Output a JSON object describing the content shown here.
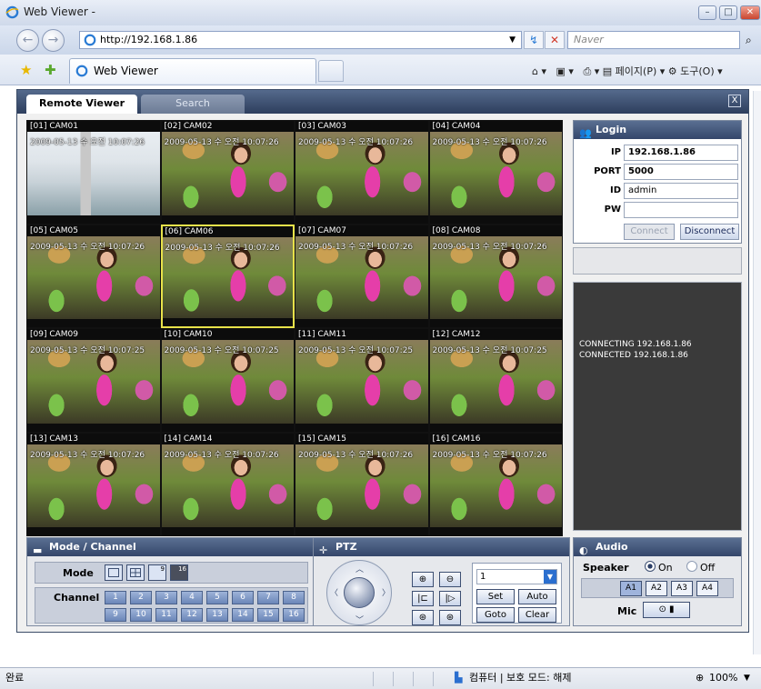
{
  "window": {
    "title": "Web Viewer -"
  },
  "address": {
    "url": "http://192.168.1.86",
    "search_placeholder": "Naver"
  },
  "tab": {
    "title": "Web Viewer"
  },
  "toolbar": {
    "page_label": "페이지(P)",
    "tools_label": "도구(O)"
  },
  "app": {
    "tabs": [
      "Remote Viewer",
      "Search"
    ],
    "close_label": "X"
  },
  "cameras": [
    {
      "label": "[01] CAM01",
      "timestamp": "2009-05-13 수 오전 10:07:26"
    },
    {
      "label": "[02] CAM02",
      "timestamp": "2009-05-13 수 오전 10:07:26"
    },
    {
      "label": "[03] CAM03",
      "timestamp": "2009-05-13 수 오전 10:07:26"
    },
    {
      "label": "[04] CAM04",
      "timestamp": "2009-05-13 수 오전 10:07:26"
    },
    {
      "label": "[05] CAM05",
      "timestamp": "2009-05-13 수 오전 10:07:26"
    },
    {
      "label": "[06] CAM06",
      "timestamp": "2009-05-13 수 오전 10:07:26"
    },
    {
      "label": "[07] CAM07",
      "timestamp": "2009-05-13 수 오전 10:07:26"
    },
    {
      "label": "[08] CAM08",
      "timestamp": "2009-05-13 수 오전 10:07:26"
    },
    {
      "label": "[09] CAM09",
      "timestamp": "2009-05-13 수 오전 10:07:25"
    },
    {
      "label": "[10] CAM10",
      "timestamp": "2009-05-13 수 오전 10:07:25"
    },
    {
      "label": "[11] CAM11",
      "timestamp": "2009-05-13 수 오전 10:07:25"
    },
    {
      "label": "[12] CAM12",
      "timestamp": "2009-05-13 수 오전 10:07:25"
    },
    {
      "label": "[13] CAM13",
      "timestamp": "2009-05-13 수 오전 10:07:26"
    },
    {
      "label": "[14] CAM14",
      "timestamp": "2009-05-13 수 오전 10:07:26"
    },
    {
      "label": "[15] CAM15",
      "timestamp": "2009-05-13 수 오전 10:07:26"
    },
    {
      "label": "[16] CAM16",
      "timestamp": "2009-05-13 수 오전 10:07:26"
    }
  ],
  "login": {
    "header": "Login",
    "ip_label": "IP",
    "ip": "192.168.1.86",
    "port_label": "PORT",
    "port": "5000",
    "id_label": "ID",
    "id": "admin",
    "pw_label": "PW",
    "pw": "",
    "connect_label": "Connect",
    "disconnect_label": "Disconnect"
  },
  "log": {
    "lines": [
      "CONNECTING 192.168.1.86",
      "CONNECTED 192.168.1.86"
    ]
  },
  "mode_channel": {
    "header": "Mode / Channel",
    "mode_label": "Mode",
    "mode_16_label": "16",
    "mode_9_label": "9",
    "channel_label": "Channel",
    "channels": [
      "1",
      "2",
      "3",
      "4",
      "5",
      "6",
      "7",
      "8",
      "9",
      "10",
      "11",
      "12",
      "13",
      "14",
      "15",
      "16"
    ]
  },
  "ptz": {
    "header": "PTZ",
    "preset_value": "1",
    "set_label": "Set",
    "auto_label": "Auto",
    "goto_label": "Goto",
    "clear_label": "Clear"
  },
  "audio": {
    "header": "Audio",
    "speaker_label": "Speaker",
    "on_label": "On",
    "off_label": "Off",
    "channels": [
      "A1",
      "A2",
      "A3",
      "A4"
    ],
    "mic_label": "Mic"
  },
  "status": {
    "left": "완료",
    "zone": "컴퓨터 | 보호 모드: 해제",
    "zoom": "100%"
  }
}
